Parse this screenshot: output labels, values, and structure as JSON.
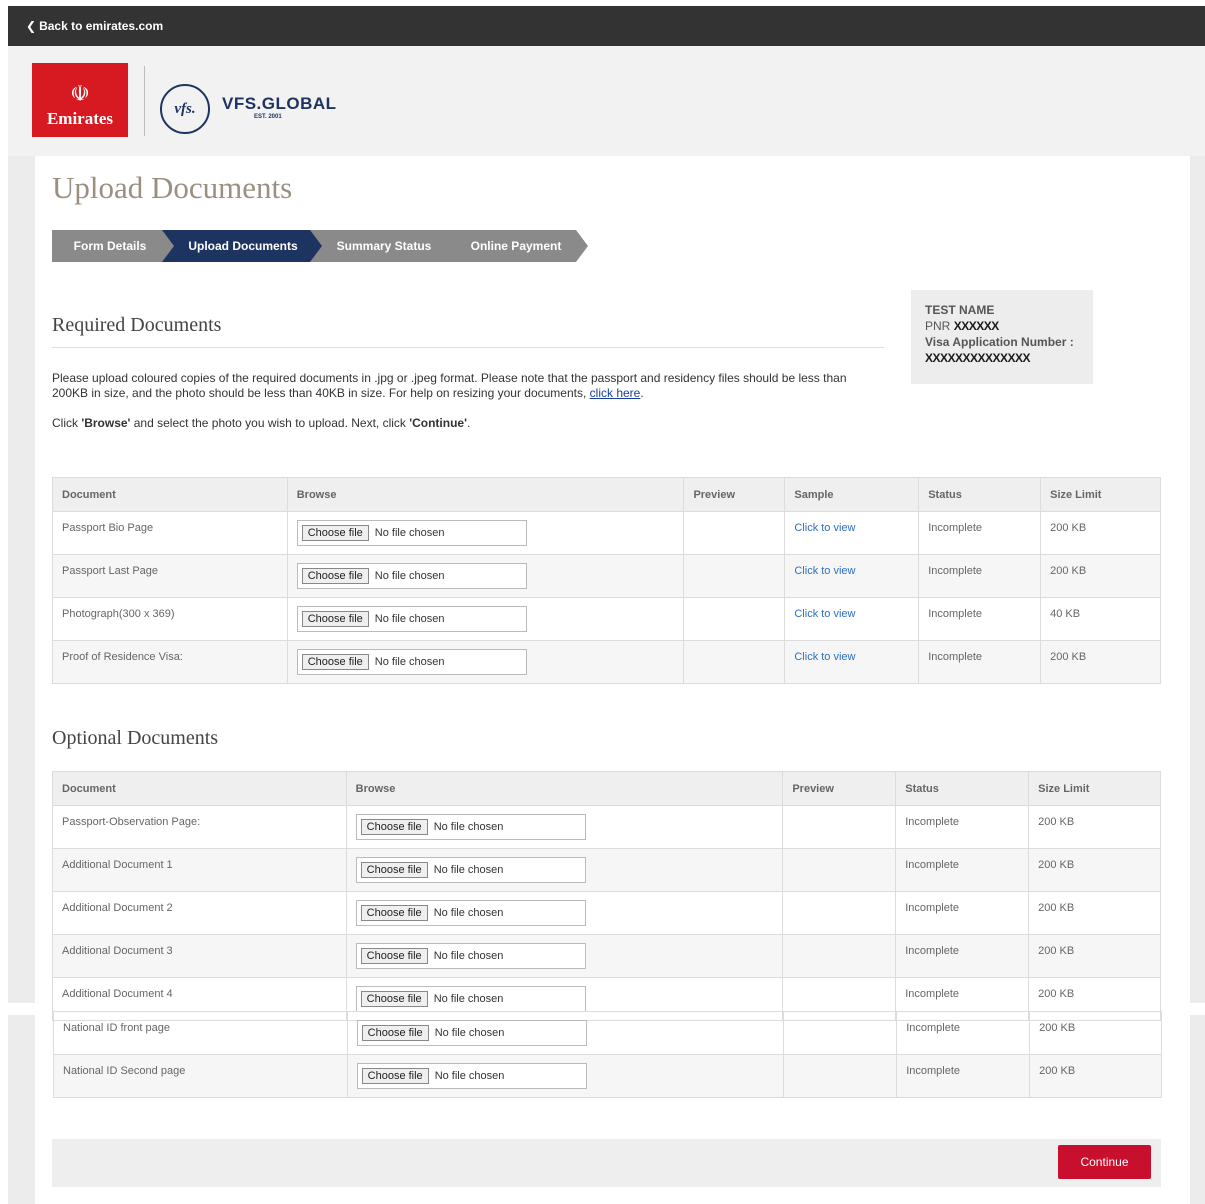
{
  "topbar": {
    "back_label": "Back to emirates.com"
  },
  "logos": {
    "emirates": "Emirates",
    "vfs_mark": "vfs.",
    "vfs_name": "VFS.GLOBAL",
    "vfs_est": "EST. 2001"
  },
  "page_title": "Upload Documents",
  "steps": [
    {
      "label": "Form Details",
      "state": "completed"
    },
    {
      "label": "Upload Documents",
      "state": "active"
    },
    {
      "label": "Summary Status",
      "state": "pending"
    },
    {
      "label": "Online Payment",
      "state": "pending"
    }
  ],
  "required_title": "Required Documents",
  "info": {
    "name": "TEST NAME",
    "pnr_label": "PNR",
    "pnr_value": "XXXXXX",
    "visa_label": "Visa Application Number :",
    "visa_value": "XXXXXXXXXXXXXX"
  },
  "instructions": {
    "p1_text": "Please upload coloured copies of the required documents in .jpg or .jpeg format. Please note that the passport and residency files should be less than 200KB in size, and the photo should be less than 40KB in size. For help on resizing your documents,",
    "p1_link": "click here",
    "p2_pre": "Click",
    "p2_browse": "'Browse'",
    "p2_mid": "and select the photo you wish to upload. Next, click",
    "p2_continue": "'Continue'"
  },
  "required_table": {
    "headers": [
      "Document",
      "Browse",
      "Preview",
      "Sample",
      "Status",
      "Size Limit"
    ],
    "rows": [
      {
        "document": "Passport Bio Page",
        "sample": "Click to view",
        "status": "Incomplete",
        "size": "200 KB"
      },
      {
        "document": "Passport Last Page",
        "sample": "Click to view",
        "status": "Incomplete",
        "size": "200 KB"
      },
      {
        "document": "Photograph(300 x 369)",
        "sample": "Click to view",
        "status": "Incomplete",
        "size": "40 KB"
      },
      {
        "document": "Proof of Residence Visa:",
        "sample": "Click to view",
        "status": "Incomplete",
        "size": "200 KB"
      }
    ]
  },
  "file_input": {
    "button": "Choose file",
    "empty": "No file chosen"
  },
  "optional_title": "Optional Documents",
  "optional_table": {
    "headers": [
      "Document",
      "Browse",
      "Preview",
      "Status",
      "Size Limit"
    ],
    "rows": [
      {
        "document": "Passport-Observation Page:",
        "status": "Incomplete",
        "size": "200 KB"
      },
      {
        "document": "Additional Document 1",
        "status": "Incomplete",
        "size": "200 KB"
      },
      {
        "document": "Additional Document 2",
        "status": "Incomplete",
        "size": "200 KB"
      },
      {
        "document": "Additional Document 3",
        "status": "Incomplete",
        "size": "200 KB"
      },
      {
        "document": "Additional Document 4",
        "status": "Incomplete",
        "size": "200 KB"
      },
      {
        "document": "National ID front page",
        "status": "Incomplete",
        "size": "200 KB"
      },
      {
        "document": "National ID Second page",
        "status": "Incomplete",
        "size": "200 KB"
      }
    ]
  },
  "continue_label": "Continue",
  "colors": {
    "brand_red": "#c8102e",
    "navy": "#1d3461",
    "step_grey": "#8a8a8a"
  }
}
